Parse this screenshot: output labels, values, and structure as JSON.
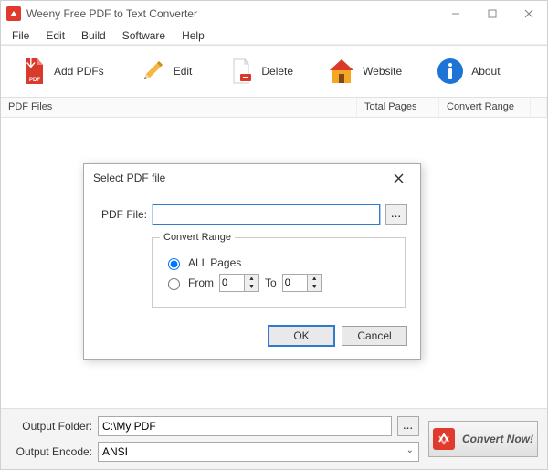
{
  "titlebar": {
    "title": "Weeny Free PDF to Text Converter"
  },
  "menu": {
    "items": [
      "File",
      "Edit",
      "Build",
      "Software",
      "Help"
    ]
  },
  "toolbar": {
    "add": "Add PDFs",
    "edit": "Edit",
    "delete": "Delete",
    "website": "Website",
    "about": "About"
  },
  "columns": {
    "files": "PDF Files",
    "pages": "Total Pages",
    "range": "Convert Range"
  },
  "dialog": {
    "title": "Select PDF file",
    "file_label": "PDF File:",
    "file_value": "",
    "fieldset": "Convert Range",
    "all_pages": "ALL Pages",
    "from": "From",
    "to": "To",
    "from_val": "0",
    "to_val": "0",
    "ok": "OK",
    "cancel": "Cancel"
  },
  "bottom": {
    "folder_label": "Output Folder:",
    "folder_value": "C:\\My PDF",
    "encode_label": "Output Encode:",
    "encode_value": "ANSI",
    "convert": "Convert Now!"
  }
}
